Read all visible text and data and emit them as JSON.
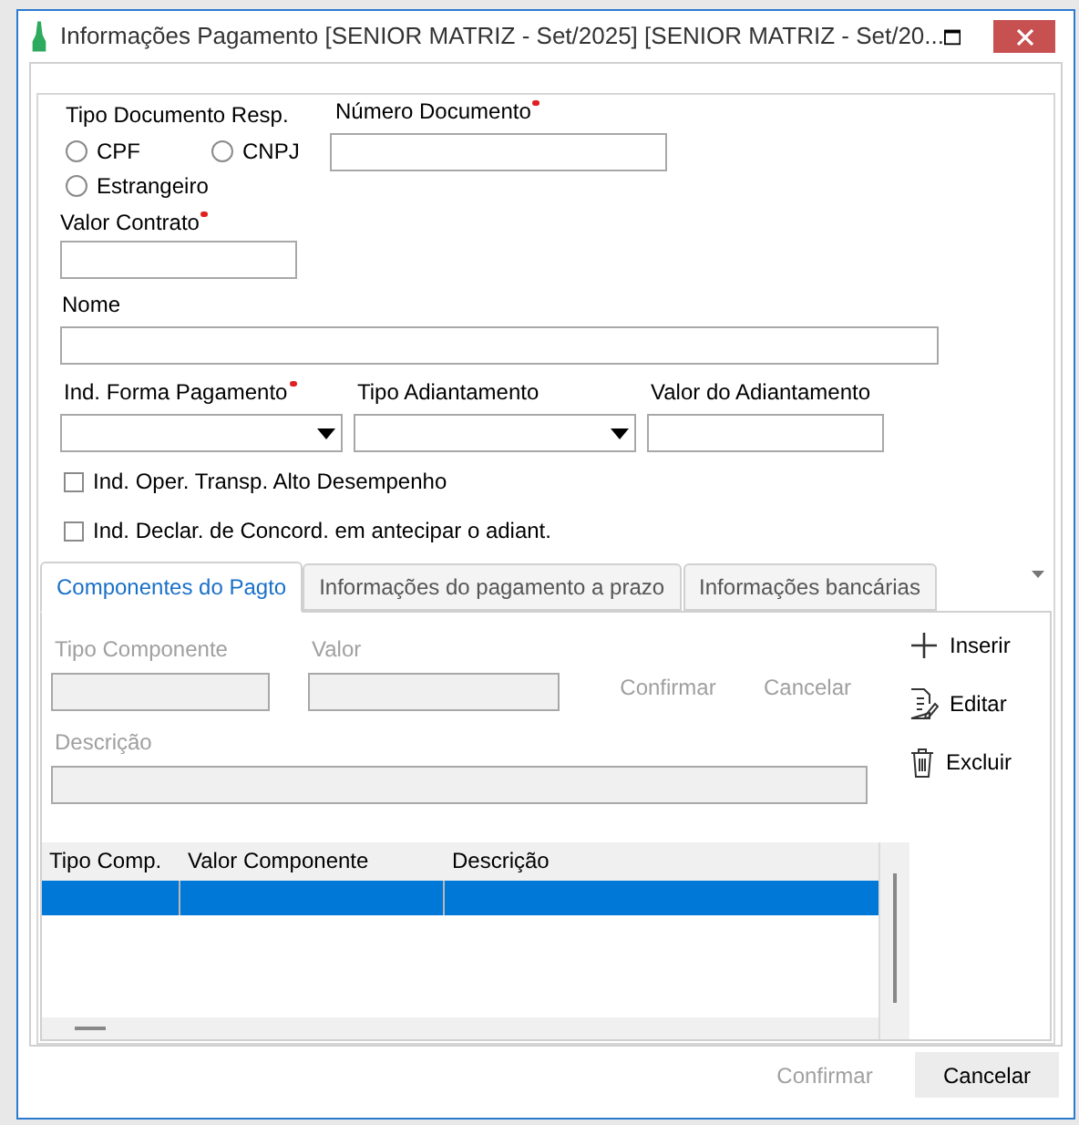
{
  "window": {
    "title": "Informações Pagamento [SENIOR MATRIZ - Set/2025]  [SENIOR MATRIZ - Set/20..."
  },
  "form": {
    "document_type": {
      "label": "Tipo Documento Resp.",
      "required": false,
      "options": [
        {
          "label": "CPF",
          "checked": false
        },
        {
          "label": "CNPJ",
          "checked": false
        },
        {
          "label": "Estrangeiro",
          "checked": false
        }
      ]
    },
    "document_number": {
      "label": "Número Documento",
      "required": true
    },
    "contract_value": {
      "label": "Valor Contrato",
      "required": true
    },
    "name": {
      "label": "Nome",
      "required": false
    },
    "payment_form": {
      "label": "Ind. Forma Pagamento",
      "required": true
    },
    "advance_type": {
      "label": "Tipo Adiantamento",
      "required": false
    },
    "advance_value": {
      "label": "Valor do Adiantamento",
      "required": false
    },
    "checkboxes": [
      {
        "label": "Ind. Oper. Transp. Alto Desempenho",
        "checked": false
      },
      {
        "label": "Ind. Declar. de Concord. em antecipar o adiant.",
        "checked": false
      }
    ]
  },
  "tabs": [
    {
      "label": "Componentes do Pagto",
      "selected": true
    },
    {
      "label": "Informações do pagamento a prazo",
      "selected": false
    },
    {
      "label": "Informações bancárias",
      "selected": false
    }
  ],
  "component_editor": {
    "type_label": "Tipo Componente",
    "value_label": "Valor",
    "description_label": "Descrição",
    "disabled": true,
    "confirm": {
      "label": "Confirmar",
      "disabled": true
    },
    "cancel": {
      "label": "Cancelar",
      "disabled": true
    }
  },
  "side_actions": [
    {
      "kind": "add",
      "label": "Inserir"
    },
    {
      "kind": "edit",
      "label": "Editar"
    },
    {
      "kind": "delete",
      "label": "Excluir"
    }
  ],
  "table": {
    "columns": [
      "Tipo Comp.",
      "Valor Componente",
      "Descrição"
    ],
    "rows": [
      {
        "selected": true
      }
    ]
  },
  "footer": [
    {
      "label": "Confirmar",
      "disabled": true
    },
    {
      "label": "Cancelar",
      "disabled": false
    }
  ]
}
